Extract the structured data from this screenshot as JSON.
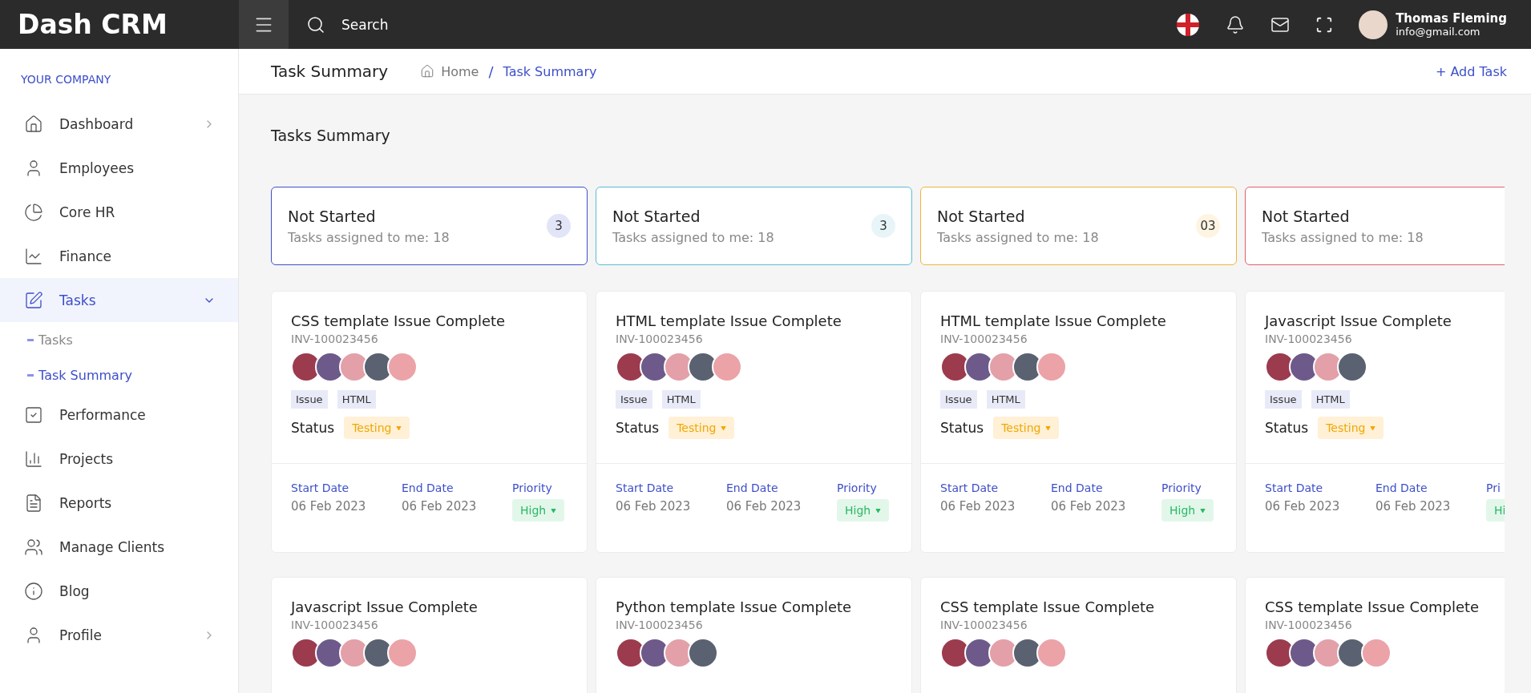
{
  "header": {
    "logo": "Dash CRM",
    "search": {
      "placeholder": "Search"
    },
    "user": {
      "name": "Thomas Fleming",
      "email": "info@gmail.com"
    }
  },
  "sidebar": {
    "heading": "YOUR COMPANY",
    "items": [
      {
        "label": "Dashboard",
        "selected": false,
        "expanded": false
      },
      {
        "label": "Employees",
        "selected": false
      },
      {
        "label": "Core HR",
        "selected": false
      },
      {
        "label": "Finance",
        "selected": false
      },
      {
        "label": "Tasks",
        "selected": true,
        "expanded": true,
        "children": [
          {
            "label": "Tasks",
            "selected": false
          },
          {
            "label": "Task Summary",
            "selected": true
          }
        ]
      },
      {
        "label": "Performance",
        "selected": false
      },
      {
        "label": "Projects",
        "selected": false
      },
      {
        "label": "Reports",
        "selected": false
      },
      {
        "label": "Manage Clients",
        "selected": false
      },
      {
        "label": "Blog",
        "selected": false
      },
      {
        "label": "Profile",
        "selected": false,
        "expanded": false
      }
    ]
  },
  "page": {
    "title": "Task Summary",
    "separator": "/",
    "breadcrumb": [
      {
        "label": "Home",
        "selected": false
      },
      {
        "label": "Task Summary",
        "selected": true
      }
    ],
    "action": "+ Add Task"
  },
  "section_title": "Tasks Summary",
  "stats": [
    {
      "title": "Not Started",
      "subtitle": "Tasks assigned to me: 18",
      "count": "3",
      "color": "#3d4fc9"
    },
    {
      "title": "Not Started",
      "subtitle": "Tasks assigned to me: 18",
      "count": "3",
      "color": "#5bbcd6"
    },
    {
      "title": "Not Started",
      "subtitle": "Tasks assigned to me: 18",
      "count": "03",
      "color": "#f0b43a"
    },
    {
      "title": "Not Started",
      "subtitle": "Tasks assigned to me: 18",
      "color": "#e0606e"
    }
  ],
  "tasks": [
    {
      "title": "CSS template Issue Complete",
      "id": "INV-100023456",
      "avatars": [
        {
          "color": "#9c3b4e"
        },
        {
          "color": "#6d5a8a"
        },
        {
          "color": "#e3a0a8"
        },
        {
          "color": "#5a6170"
        },
        {
          "color": "#eba3a8"
        }
      ],
      "tags": [
        "Issue",
        "HTML"
      ],
      "status_label": "Status",
      "status": "Testing",
      "dates": [
        {
          "label": "Start Date",
          "value": "06 Feb 2023"
        },
        {
          "label": "End Date",
          "value": "06 Feb 2023"
        }
      ],
      "priority_label": "Priority",
      "priority": "High"
    },
    {
      "title": "HTML template Issue Complete",
      "id": "INV-100023456",
      "avatars": [
        {
          "color": "#9c3b4e"
        },
        {
          "color": "#6d5a8a"
        },
        {
          "color": "#e3a0a8"
        },
        {
          "color": "#5a6170"
        },
        {
          "color": "#eba3a8"
        }
      ],
      "tags": [
        "Issue",
        "HTML"
      ],
      "status_label": "Status",
      "status": "Testing",
      "dates": [
        {
          "label": "Start Date",
          "value": "06 Feb 2023"
        },
        {
          "label": "End Date",
          "value": "06 Feb 2023"
        }
      ],
      "priority_label": "Priority",
      "priority": "High"
    },
    {
      "title": "HTML template Issue Complete",
      "id": "INV-100023456",
      "avatars": [
        {
          "color": "#9c3b4e"
        },
        {
          "color": "#6d5a8a"
        },
        {
          "color": "#e3a0a8"
        },
        {
          "color": "#5a6170"
        },
        {
          "color": "#eba3a8"
        }
      ],
      "tags": [
        "Issue",
        "HTML"
      ],
      "status_label": "Status",
      "status": "Testing",
      "dates": [
        {
          "label": "Start Date",
          "value": "06 Feb 2023"
        },
        {
          "label": "End Date",
          "value": "06 Feb 2023"
        }
      ],
      "priority_label": "Priority",
      "priority": "High"
    },
    {
      "title": "Javascript Issue Complete",
      "id": "INV-100023456",
      "avatars": [
        {
          "color": "#9c3b4e"
        },
        {
          "color": "#6d5a8a"
        },
        {
          "color": "#e3a0a8"
        },
        {
          "color": "#5a6170"
        }
      ],
      "tags": [
        "Issue",
        "HTML"
      ],
      "status_label": "Status",
      "status": "Testing",
      "dates": [
        {
          "label": "Start Date",
          "value": "06 Feb 2023"
        },
        {
          "label": "End Date",
          "value": "06 Feb 2023"
        }
      ],
      "priority_label": "Pri",
      "priority": "Hi"
    },
    {
      "title": "Javascript Issue Complete",
      "id": "INV-100023456",
      "avatars": [
        {
          "color": "#9c3b4e"
        },
        {
          "color": "#6d5a8a"
        },
        {
          "color": "#e3a0a8"
        },
        {
          "color": "#5a6170"
        },
        {
          "color": "#eba3a8"
        }
      ]
    },
    {
      "title": "Python template Issue Complete",
      "id": "INV-100023456",
      "avatars": [
        {
          "color": "#9c3b4e"
        },
        {
          "color": "#6d5a8a"
        },
        {
          "color": "#e3a0a8"
        },
        {
          "color": "#5a6170"
        }
      ]
    },
    {
      "title": "CSS template Issue Complete",
      "id": "INV-100023456",
      "avatars": [
        {
          "color": "#9c3b4e"
        },
        {
          "color": "#6d5a8a"
        },
        {
          "color": "#e3a0a8"
        },
        {
          "color": "#5a6170"
        },
        {
          "color": "#eba3a8"
        }
      ]
    },
    {
      "title": "CSS template Issue Complete",
      "id": "INV-100023456",
      "avatars": [
        {
          "color": "#9c3b4e"
        },
        {
          "color": "#6d5a8a"
        },
        {
          "color": "#e3a0a8"
        },
        {
          "color": "#5a6170"
        },
        {
          "color": "#eba3a8"
        }
      ]
    }
  ]
}
